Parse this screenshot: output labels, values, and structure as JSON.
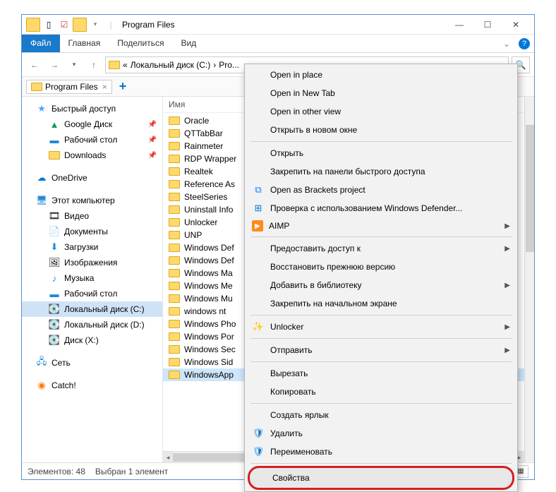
{
  "title": "Program Files",
  "ribbon": {
    "file": "Файл",
    "home": "Главная",
    "share": "Поделиться",
    "view": "Вид"
  },
  "address": {
    "sep": "«",
    "disk": "Локальный диск (C:)",
    "crumb": "Pro..."
  },
  "tab": {
    "label": "Program Files"
  },
  "nav": {
    "quick": "Быстрый доступ",
    "gdrive": "Google Диск",
    "desktop": "Рабочий стол",
    "downloads": "Downloads",
    "onedrive": "OneDrive",
    "thispc": "Этот компьютер",
    "video": "Видео",
    "documents": "Документы",
    "downloads2": "Загрузки",
    "pictures": "Изображения",
    "music": "Музыка",
    "desktop2": "Рабочий стол",
    "diskC": "Локальный диск (C:)",
    "diskD": "Локальный диск (D:)",
    "diskX": "Диск (X:)",
    "network": "Сеть",
    "catch": "Catch!"
  },
  "col_name": "Имя",
  "files": [
    "Oracle",
    "QTTabBar",
    "Rainmeter",
    "RDP Wrapper",
    "Realtek",
    "Reference As",
    "SteelSeries",
    "Uninstall Info",
    "Unlocker",
    "UNP",
    "Windows Def",
    "Windows Def",
    "Windows Ma",
    "Windows Me",
    "Windows Mu",
    "windows nt",
    "Windows Pho",
    "Windows Por",
    "Windows Sec",
    "Windows Sid",
    "WindowsApp"
  ],
  "menu": {
    "open_in_place": "Open in place",
    "open_new_tab": "Open in New Tab",
    "open_other_view": "Open in other view",
    "open_new_window": "Открыть в новом окне",
    "open": "Открыть",
    "pin_quick": "Закрепить на панели быстрого доступа",
    "brackets": "Open as Brackets project",
    "defender": "Проверка с использованием Windows Defender...",
    "aimp": "AIMP",
    "grant_access": "Предоставить доступ к",
    "restore": "Восстановить прежнюю версию",
    "add_library": "Добавить в библиотеку",
    "pin_start": "Закрепить на начальном экране",
    "unlocker": "Unlocker",
    "send_to": "Отправить",
    "cut": "Вырезать",
    "copy": "Копировать",
    "shortcut": "Создать ярлык",
    "delete": "Удалить",
    "rename": "Переименовать",
    "properties": "Свойства"
  },
  "status": {
    "count": "Элементов: 48",
    "selected": "Выбран 1 элемент"
  }
}
